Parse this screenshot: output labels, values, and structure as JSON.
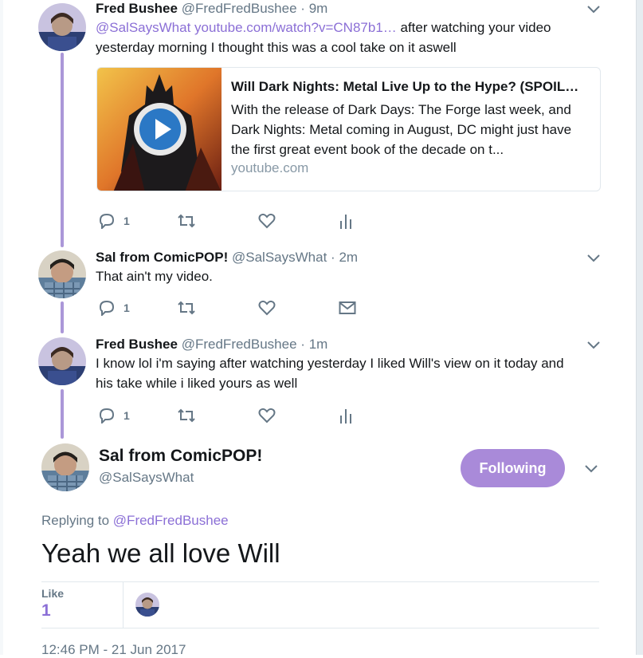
{
  "tweets": [
    {
      "name": "Fred Bushee",
      "handle": "@FredFredBushee",
      "time": "9m",
      "mention": "@SalSaysWhat",
      "link": "youtube.com/watch?v=CN87b1…",
      "text_after_link": " after watching your video",
      "text_line2": "yesterday morning I thought this was a cool take on it aswell",
      "card": {
        "title": "Will Dark Nights: Metal Live Up to the Hype? (SPOIL…",
        "description": "With the release of Dark Days: The Forge last week, and Dark Nights: Metal coming in August, DC might just have the first great event book of the decade on t...",
        "domain": "youtube.com"
      },
      "reply_count": "1"
    },
    {
      "name": "Sal from ComicPOP!",
      "handle": "@SalSaysWhat",
      "time": "2m",
      "text": "That ain't my video.",
      "reply_count": "1"
    },
    {
      "name": "Fred Bushee",
      "handle": "@FredFredBushee",
      "time": "1m",
      "text": "I know lol i'm saying after watching yesterday I liked Will's view on it today and his take while i liked yours as well",
      "reply_count": "1"
    }
  ],
  "main_tweet": {
    "name": "Sal from ComicPOP!",
    "handle": "@SalSaysWhat",
    "follow_label": "Following",
    "replying_prefix": "Replying to",
    "replying_to": "@FredFredBushee",
    "text": "Yeah we all love Will",
    "likes_label": "Like",
    "likes_count": "1",
    "timestamp": "12:46 PM - 21 Jun 2017"
  },
  "separator": "·",
  "colors": {
    "accent": "#8b6fd6",
    "follow_button": "#a98ad9",
    "thread_line": "#ab97d8",
    "muted": "#657786"
  },
  "icons": [
    "reply-icon",
    "retweet-icon",
    "like-icon",
    "analytics-icon",
    "direct-message-icon",
    "chevron-down-icon",
    "play-icon"
  ]
}
